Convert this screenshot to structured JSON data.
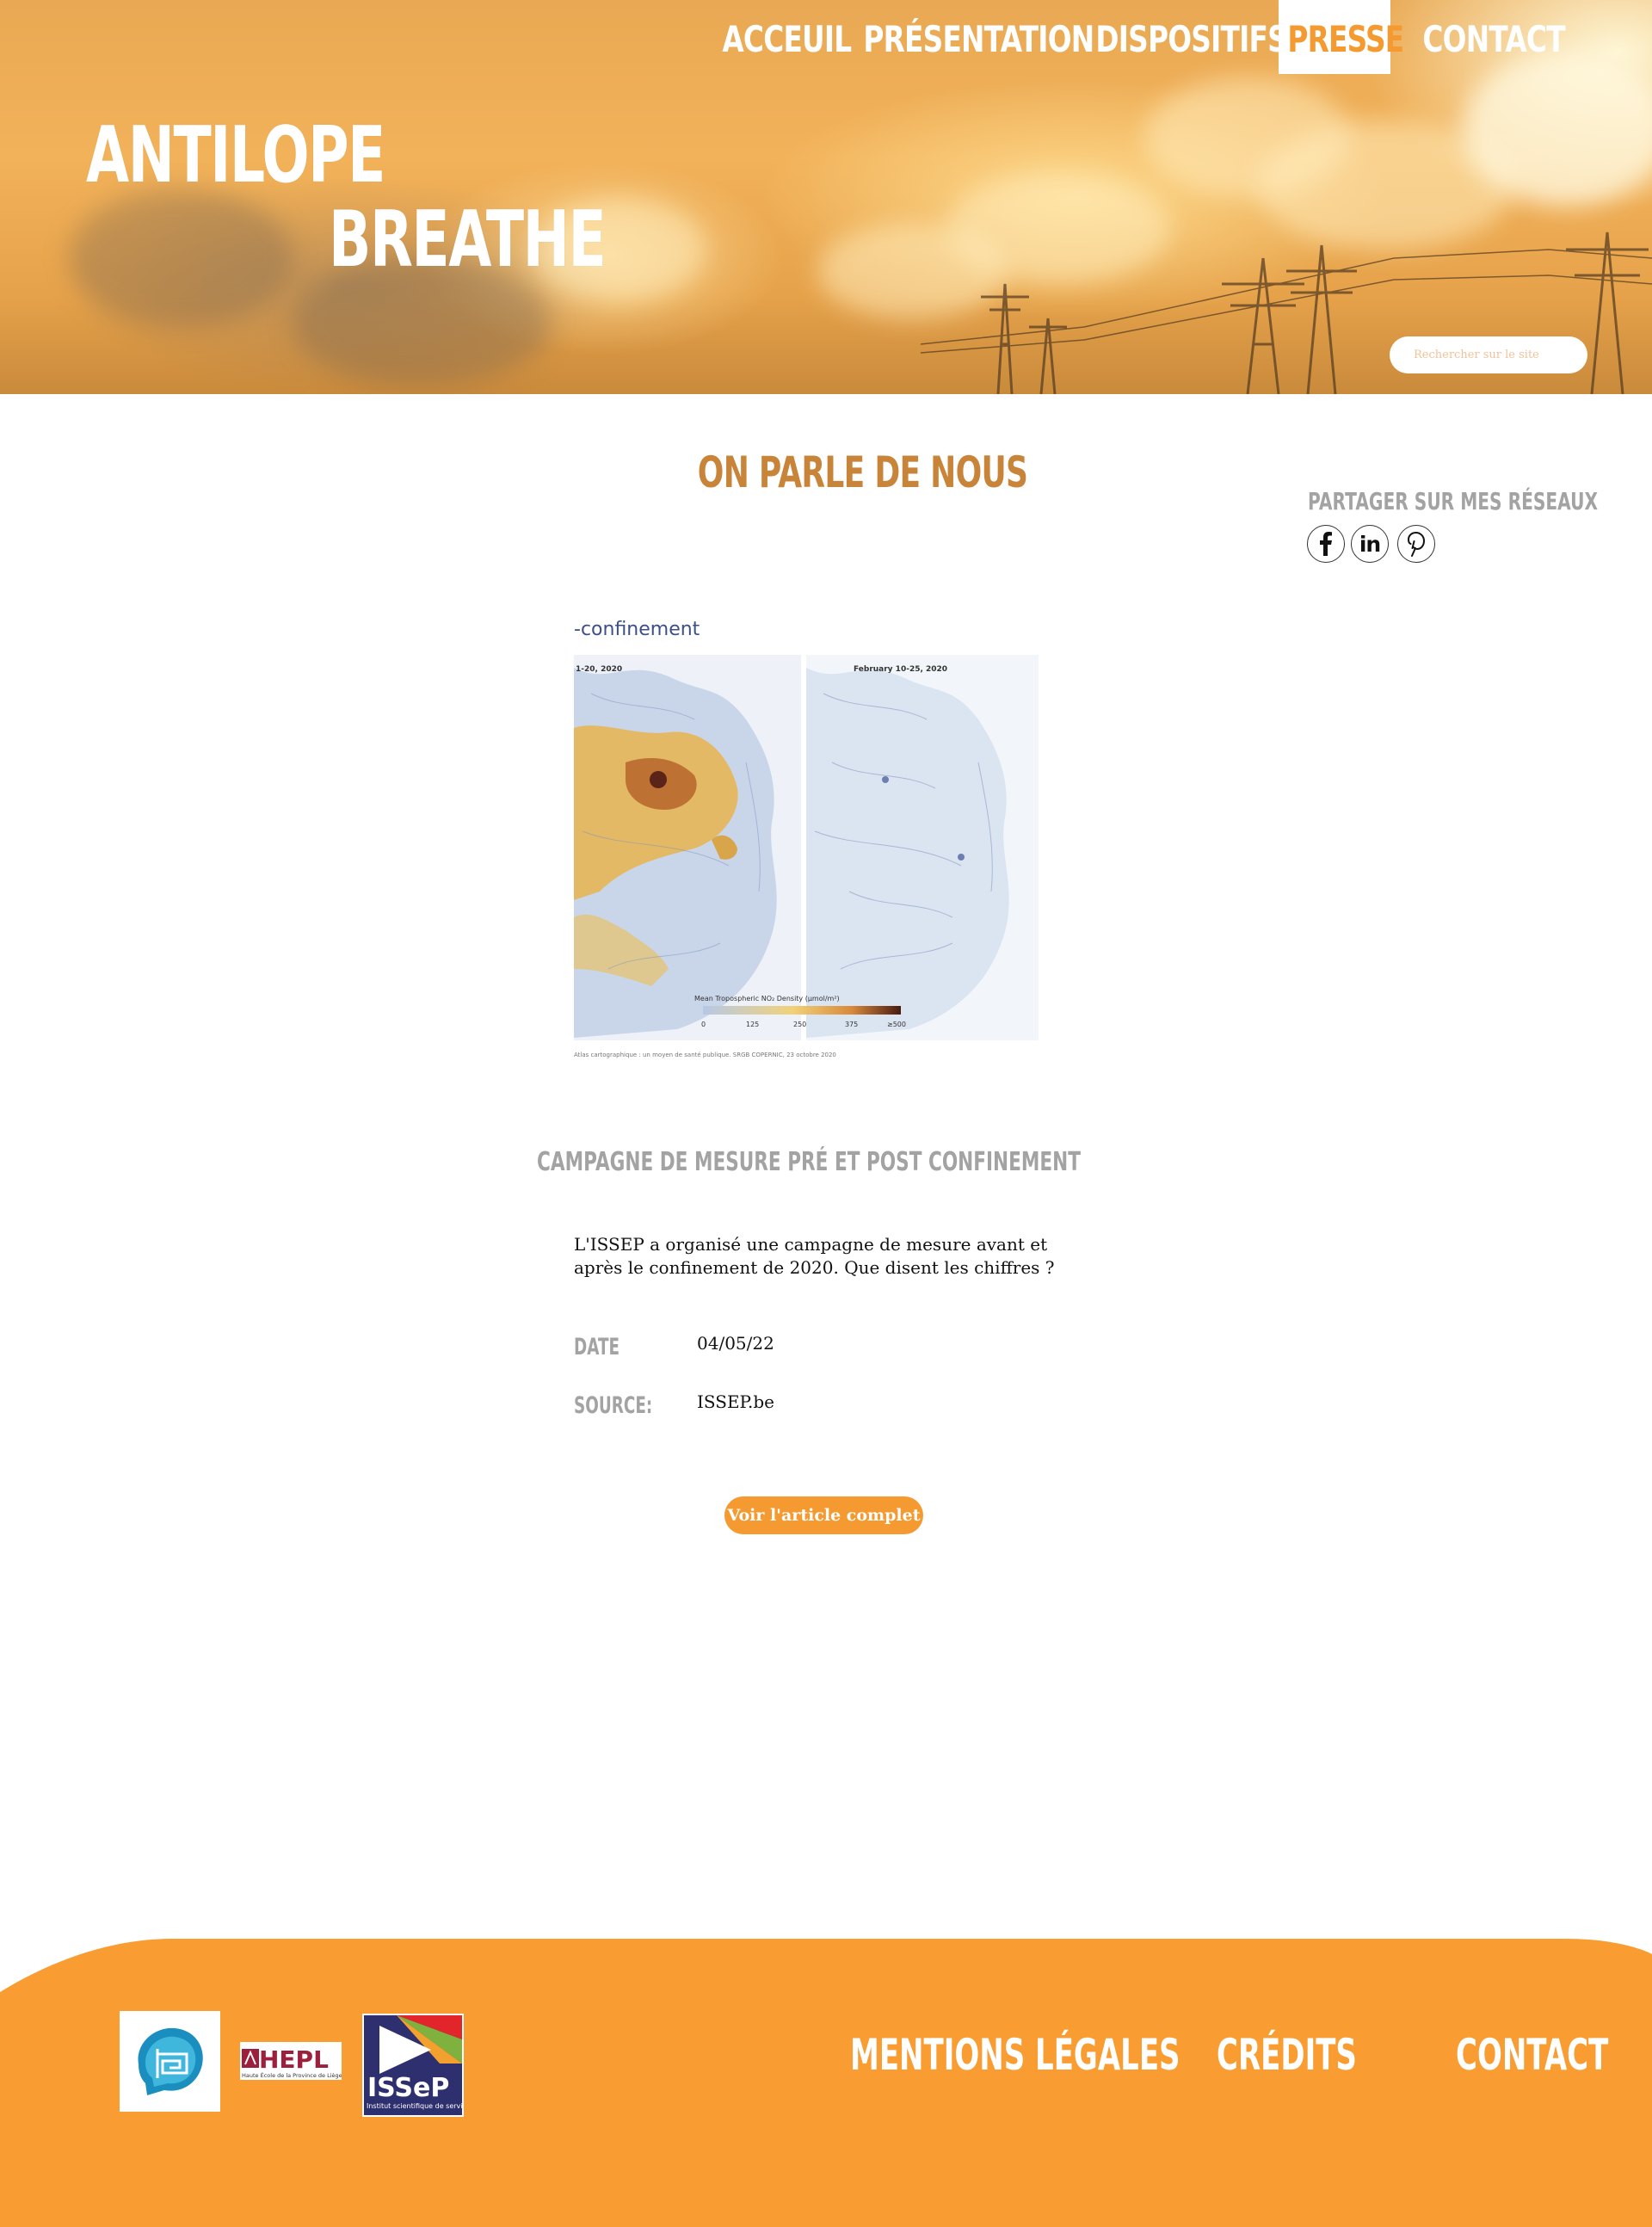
{
  "header": {
    "nav": [
      {
        "label": "ACCEUIL",
        "active": false
      },
      {
        "label": "PRÉSENTATION",
        "active": false
      },
      {
        "label": "DISPOSITIFS",
        "active": false
      },
      {
        "label": "PRESSE",
        "active": true
      },
      {
        "label": "CONTACT",
        "active": false
      }
    ],
    "logo_line1": "ANTILOPE",
    "logo_line2": "BREATHE",
    "search_placeholder": "Rechercher sur le site"
  },
  "main": {
    "title": "ON PARLE DE NOUS",
    "share_label": "PARTAGER SUR MES RÉSEAUX",
    "social_icons": [
      "facebook-icon",
      "linkedin-icon",
      "pinterest-icon"
    ],
    "image_caption_title": "-confinement",
    "image_date_left": "1-20, 2020",
    "image_date_right": "February 10-25, 2020",
    "image_legend": "Mean Tropospheric NO₂ Density (µmol/m²)",
    "image_legend_ticks": [
      "0",
      "125",
      "250",
      "375",
      "≥500"
    ],
    "image_footnote": "Atlas cartographique : un moyen de santé publique. SRGB COPERNIC, 23 octobre 2020",
    "article_subtitle": "CAMPAGNE DE MESURE PRÉ ET POST CONFINEMENT",
    "article_description": "L'ISSEP a organisé une campagne de mesure avant et après le confinement de 2020. Que disent les chiffres ?",
    "date_label": "DATE",
    "date_value": "04/05/22",
    "source_label": "SOURCE:",
    "source_value": "ISSEP.be",
    "cta_label": "Voir l'article complet"
  },
  "footer": {
    "links": [
      "MENTIONS LÉGALES",
      "CRÉDITS",
      "CONTACT"
    ],
    "partners": {
      "hepl_text": "HEPL",
      "hepl_subtext": "Haute École de la Province de Liège",
      "issep_text": "ISSeP",
      "issep_subtext": "Institut scientifique de service public"
    }
  },
  "colors": {
    "accent": "#f59a30",
    "title": "#c8853a",
    "muted": "#a3a3a3"
  }
}
